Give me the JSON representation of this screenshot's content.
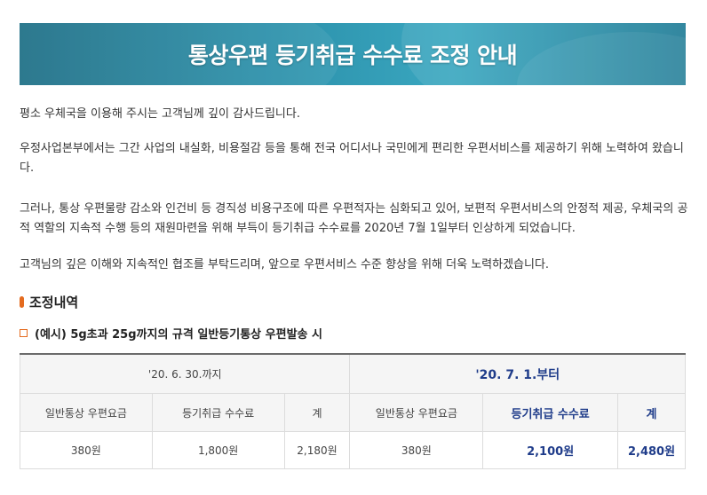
{
  "banner": {
    "title": "통상우편 등기취급 수수료 조정 안내"
  },
  "paragraphs": [
    "평소 우체국을 이용해 주시는 고객님께 깊이 감사드립니다.",
    "우정사업본부에서는 그간 사업의 내실화, 비용절감 등을 통해 전국 어디서나 국민에게 편리한 우편서비스를 제공하기 위해 노력하여 왔습니다.",
    "그러나, 통상 우편물량 감소와 인건비 등 경직성 비용구조에 따른 우편적자는 심화되고 있어, 보편적 우편서비스의 안정적 제공, 우체국의 공적 역할의 지속적 수행 등의 재원마련을 위해 부득이 등기취급 수수료를 2020년 7월 1일부터 인상하게 되었습니다.",
    "고객님의 깊은 이해와 지속적인 협조를 부탁드리며, 앞으로 우편서비스 수준 향상을 위해 더욱 노력하겠습니다."
  ],
  "section": {
    "title": "조정내역"
  },
  "example": {
    "label": "(예시) 5g초과 25g까지의 규격 일반등기통상 우편발송 시"
  },
  "table": {
    "old_period": "'20. 6. 30.까지",
    "new_period": "'20. 7. 1.부터",
    "headers": {
      "postage": "일반통상 우편요금",
      "registered_fee": "등기취급 수수료",
      "total": "계"
    },
    "old_values": {
      "postage": "380원",
      "registered_fee": "1,800원",
      "total": "2,180원"
    },
    "new_values": {
      "postage": "380원",
      "registered_fee": "2,100원",
      "total": "2,480원"
    }
  },
  "colors": {
    "banner_start": "#1e6f86",
    "banner_end": "#3aa7c0",
    "accent_orange": "#e46b1f",
    "new_value_blue": "#1f3c8a"
  }
}
